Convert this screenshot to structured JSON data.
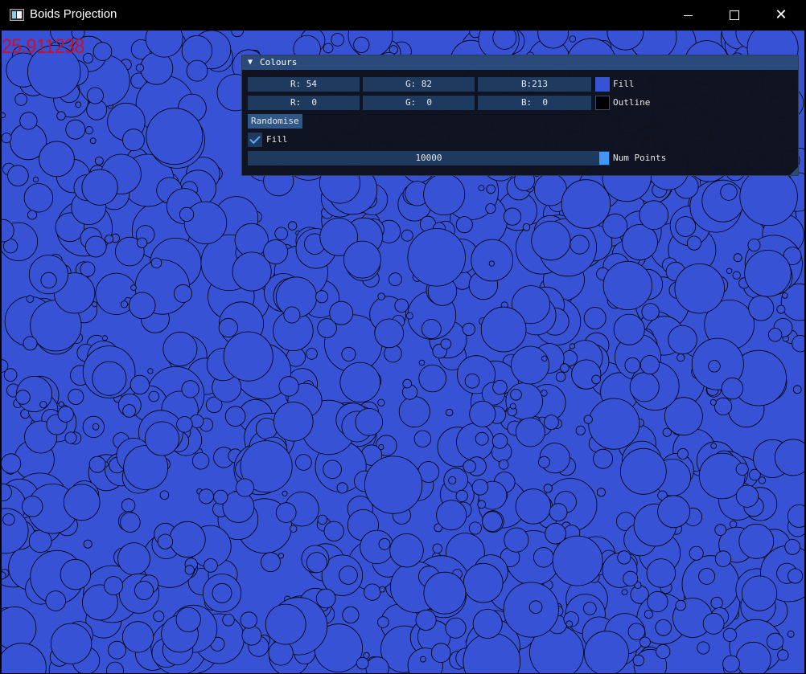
{
  "window": {
    "title": "Boids Projection",
    "controls": {
      "minimize": "minimize",
      "maximize": "maximize",
      "close": "✕"
    }
  },
  "fps": "25.911238",
  "panel": {
    "title": "Colours",
    "collapse_glyph": "▼",
    "fill_row": {
      "r": "R: 54",
      "g": "G: 82",
      "b": "B:213",
      "label": "Fill",
      "swatch_color": "#3652d5"
    },
    "outline_row": {
      "r": "R:  0",
      "g": "G:  0",
      "b": "B:  0",
      "label": "Outline",
      "swatch_color": "#000000"
    },
    "randomise_label": "Randomise",
    "fill_checkbox": {
      "label": "Fill",
      "checked": true
    },
    "num_points": {
      "value": "10000",
      "label": "Num Points",
      "fraction": 1.0
    }
  },
  "colors": {
    "background_fill": "#3852d5",
    "outline": "#000000",
    "fps_text": "#c8102e",
    "panel_header": "#294a7a",
    "accent": "#4296fa"
  }
}
